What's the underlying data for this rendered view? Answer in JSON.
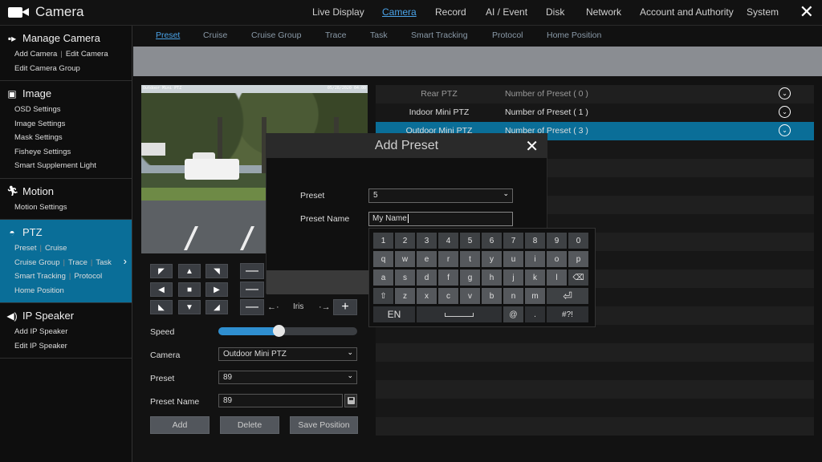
{
  "app": {
    "title": "Camera"
  },
  "top_nav": [
    {
      "label": "Live Display",
      "active": false
    },
    {
      "label": "Camera",
      "active": true
    },
    {
      "label": "Record",
      "active": false
    },
    {
      "label": "AI / Event",
      "active": false
    },
    {
      "label": "Disk",
      "active": false
    },
    {
      "label": "Network",
      "active": false
    },
    {
      "label": "Account and Authority",
      "active": false
    },
    {
      "label": "System",
      "active": false
    }
  ],
  "sidebar": {
    "manage_camera": {
      "title": "Manage Camera",
      "rows": [
        [
          "Add Camera",
          "Edit Camera"
        ],
        [
          "Edit Camera Group"
        ]
      ]
    },
    "image": {
      "title": "Image",
      "rows": [
        [
          "OSD Settings"
        ],
        [
          "Image Settings"
        ],
        [
          "Mask Settings"
        ],
        [
          "Fisheye Settings"
        ],
        [
          "Smart Supplement Light"
        ]
      ]
    },
    "motion": {
      "title": "Motion",
      "rows": [
        [
          "Motion Settings"
        ]
      ]
    },
    "ptz": {
      "title": "PTZ",
      "rows": [
        [
          "Preset",
          "Cruise"
        ],
        [
          "Cruise Group",
          "Trace",
          "Task"
        ],
        [
          "Smart Tracking",
          "Protocol"
        ],
        [
          "Home Position"
        ]
      ]
    },
    "ip_speaker": {
      "title": "IP Speaker",
      "rows": [
        [
          "Add IP Speaker"
        ],
        [
          "Edit IP Speaker"
        ]
      ]
    }
  },
  "sub_tabs": [
    {
      "label": "Preset",
      "active": true
    },
    {
      "label": "Cruise",
      "active": false
    },
    {
      "label": "Cruise Group",
      "active": false
    },
    {
      "label": "Trace",
      "active": false
    },
    {
      "label": "Task",
      "active": false
    },
    {
      "label": "Smart Tracking",
      "active": false
    },
    {
      "label": "Protocol",
      "active": false
    },
    {
      "label": "Home Position",
      "active": false
    }
  ],
  "video": {
    "osd_name": "Outdoor Mini PTZ",
    "osd_time": "05/28/2020 04:00"
  },
  "ptz_controls": {
    "iris_label": "Iris",
    "zoom_out": "—",
    "zoom_in": "+"
  },
  "form": {
    "speed_label": "Speed",
    "speed_value": 0.43,
    "camera_label": "Camera",
    "camera_value": "Outdoor Mini PTZ",
    "preset_label": "Preset",
    "preset_value": "89",
    "preset_name_label": "Preset Name",
    "preset_name_value": "89",
    "add_button": "Add",
    "delete_button": "Delete",
    "save_position_button": "Save Position"
  },
  "preset_list": [
    {
      "name": "Rear PTZ",
      "count": "Number of Preset ( 0 )",
      "state": "dim"
    },
    {
      "name": "Indoor Mini PTZ",
      "count": "Number of Preset ( 1 )",
      "state": "normal"
    },
    {
      "name": "Outdoor Mini PTZ",
      "count": "Number of Preset ( 3 )",
      "state": "selected"
    }
  ],
  "dialog": {
    "title": "Add Preset",
    "preset_label": "Preset",
    "preset_value": "5",
    "preset_name_label": "Preset Name",
    "preset_name_value": "My Name"
  },
  "keyboard": {
    "row1": [
      "1",
      "2",
      "3",
      "4",
      "5",
      "6",
      "7",
      "8",
      "9",
      "0"
    ],
    "row2": [
      "q",
      "w",
      "e",
      "r",
      "t",
      "y",
      "u",
      "i",
      "o",
      "p"
    ],
    "row3": [
      "a",
      "s",
      "d",
      "f",
      "g",
      "h",
      "j",
      "k",
      "l"
    ],
    "row4": [
      "z",
      "x",
      "c",
      "v",
      "b",
      "n",
      "m"
    ],
    "lang": "EN",
    "at": "@",
    "dot": ".",
    "symbols": "#?!"
  },
  "colors": {
    "accent": "#0a6e98",
    "link": "#4aa3e8",
    "slider": "#2f8fd0"
  }
}
